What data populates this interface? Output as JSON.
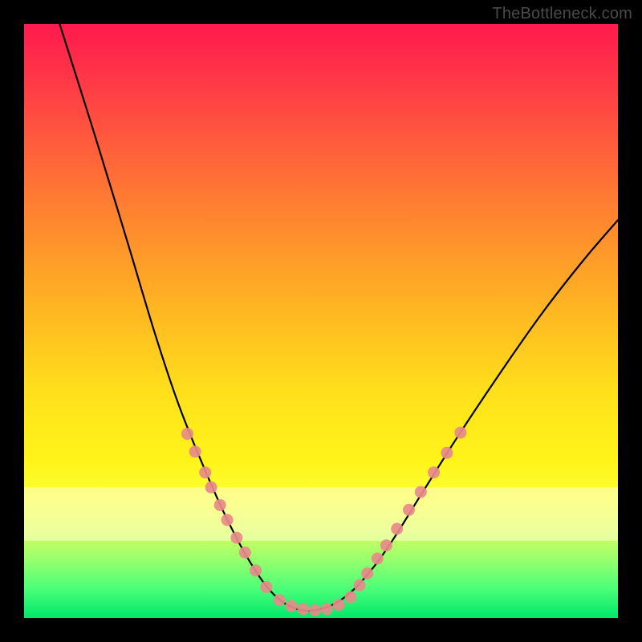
{
  "watermark": "TheBottleneck.com",
  "chart_data": {
    "type": "line",
    "title": "",
    "xlabel": "",
    "ylabel": "",
    "xlim": [
      0,
      1
    ],
    "ylim": [
      0,
      1
    ],
    "notes": "No numeric axes or tick labels are visible; the curve depicts a V-shaped bottleneck profile over a red-to-green vertical gradient. Coordinates are expressed as fractions of the plot area (0,0 top-left → 1,1 bottom-right).",
    "series": [
      {
        "name": "bottleneck-curve",
        "type": "line",
        "points": [
          {
            "x": 0.06,
            "y": 0.0
          },
          {
            "x": 0.12,
            "y": 0.19
          },
          {
            "x": 0.175,
            "y": 0.37
          },
          {
            "x": 0.22,
            "y": 0.52
          },
          {
            "x": 0.26,
            "y": 0.64
          },
          {
            "x": 0.3,
            "y": 0.74
          },
          {
            "x": 0.34,
            "y": 0.83
          },
          {
            "x": 0.38,
            "y": 0.905
          },
          {
            "x": 0.42,
            "y": 0.96
          },
          {
            "x": 0.46,
            "y": 0.985
          },
          {
            "x": 0.5,
            "y": 0.985
          },
          {
            "x": 0.54,
            "y": 0.965
          },
          {
            "x": 0.58,
            "y": 0.925
          },
          {
            "x": 0.62,
            "y": 0.87
          },
          {
            "x": 0.67,
            "y": 0.79
          },
          {
            "x": 0.73,
            "y": 0.695
          },
          {
            "x": 0.8,
            "y": 0.59
          },
          {
            "x": 0.87,
            "y": 0.49
          },
          {
            "x": 0.94,
            "y": 0.4
          },
          {
            "x": 1.0,
            "y": 0.33
          }
        ]
      },
      {
        "name": "left-scatter",
        "type": "scatter",
        "color": "#e88a8a",
        "points": [
          {
            "x": 0.275,
            "y": 0.69
          },
          {
            "x": 0.288,
            "y": 0.72
          },
          {
            "x": 0.305,
            "y": 0.755
          },
          {
            "x": 0.315,
            "y": 0.78
          },
          {
            "x": 0.33,
            "y": 0.81
          },
          {
            "x": 0.342,
            "y": 0.835
          },
          {
            "x": 0.358,
            "y": 0.865
          },
          {
            "x": 0.372,
            "y": 0.89
          },
          {
            "x": 0.39,
            "y": 0.92
          },
          {
            "x": 0.408,
            "y": 0.948
          },
          {
            "x": 0.43,
            "y": 0.97
          }
        ]
      },
      {
        "name": "bottom-scatter",
        "type": "scatter",
        "color": "#e88a8a",
        "points": [
          {
            "x": 0.45,
            "y": 0.98
          },
          {
            "x": 0.47,
            "y": 0.985
          },
          {
            "x": 0.49,
            "y": 0.987
          },
          {
            "x": 0.51,
            "y": 0.985
          },
          {
            "x": 0.53,
            "y": 0.978
          },
          {
            "x": 0.55,
            "y": 0.965
          }
        ]
      },
      {
        "name": "right-scatter",
        "type": "scatter",
        "color": "#e88a8a",
        "points": [
          {
            "x": 0.565,
            "y": 0.945
          },
          {
            "x": 0.578,
            "y": 0.925
          },
          {
            "x": 0.595,
            "y": 0.9
          },
          {
            "x": 0.61,
            "y": 0.878
          },
          {
            "x": 0.628,
            "y": 0.85
          },
          {
            "x": 0.648,
            "y": 0.818
          },
          {
            "x": 0.668,
            "y": 0.788
          },
          {
            "x": 0.69,
            "y": 0.755
          },
          {
            "x": 0.712,
            "y": 0.722
          },
          {
            "x": 0.735,
            "y": 0.688
          }
        ]
      }
    ]
  }
}
